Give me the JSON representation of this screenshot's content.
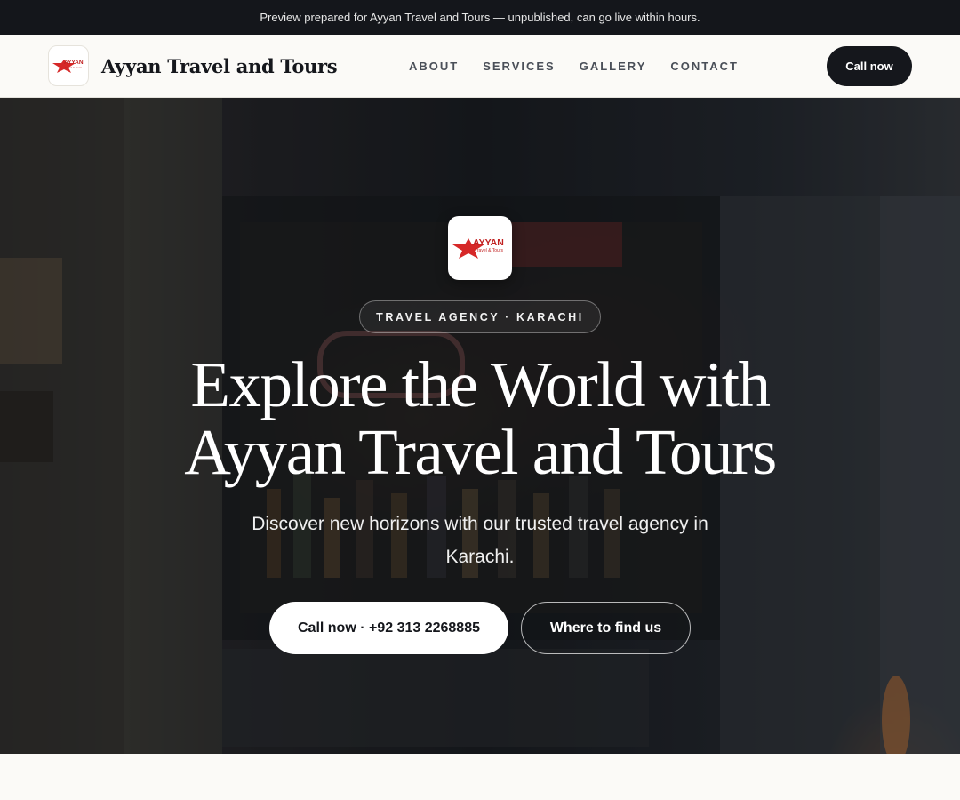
{
  "banner": {
    "text": "Preview prepared for Ayyan Travel and Tours — unpublished, can go live within hours."
  },
  "nav": {
    "brand_name": "Ayyan Travel and Tours",
    "logo_text": "AYYAN",
    "logo_subtext": "Travel & Tours",
    "links": [
      "ABOUT",
      "SERVICES",
      "GALLERY",
      "CONTACT"
    ],
    "cta_label": "Call now"
  },
  "hero": {
    "eyebrow": "TRAVEL AGENCY · KARACHI",
    "headline": "Explore the World with Ayyan Travel and Tours",
    "subhead": "Discover new horizons with our trusted travel agency in Karachi.",
    "primary_cta": "Call now · +92 313 2268885",
    "secondary_cta": "Where to find us"
  },
  "colors": {
    "dark": "#15171c",
    "accent_red": "#d62828",
    "page_bg": "#fbfaf7"
  }
}
